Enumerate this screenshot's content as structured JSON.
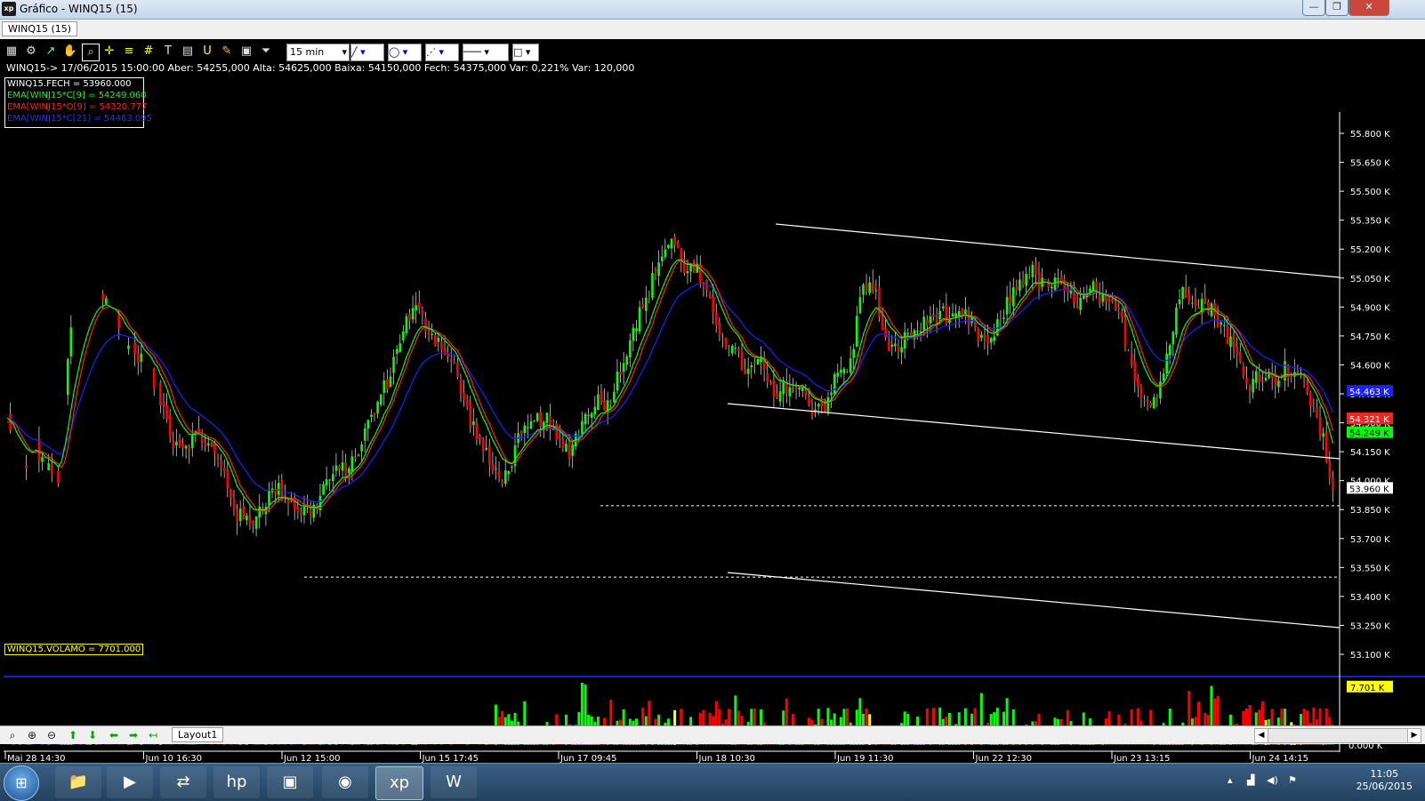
{
  "window": {
    "title": "Gráfico - WINQ15 (15)",
    "tab": "WINQ15 (15)",
    "controls": [
      "—",
      "❐",
      "✕"
    ]
  },
  "toolbar": {
    "timeframe": "15 min",
    "icons": [
      "chart-type-icon",
      "settings-icon",
      "cursor-icon",
      "hand-icon",
      "zoom-tool-icon",
      "crosshair-icon",
      "hline-icon",
      "grid-icon",
      "text-icon",
      "calculator-icon",
      "u-icon",
      "brush-icon",
      "save-icon",
      "filter-icon"
    ]
  },
  "info_line": "WINQ15-> 17/06/2015 15:00:00 Aber: 54255,000 Alta: 54625,000 Baixa: 54150,000 Fech: 54375,000 Var: 0,221% Var: 120,000",
  "legend": [
    {
      "text": "WINQ15.FECH = 53960.000",
      "color": "#ffffff"
    },
    {
      "text": "EMA[WINJ15*C[9] = 54249.060",
      "color": "#00ff00"
    },
    {
      "text": "EMA[WINJ15*O[9] = 54320.777",
      "color": "#ff2020"
    },
    {
      "text": "EMA[WINJ15*C[21] = 54463.095",
      "color": "#2030ff"
    }
  ],
  "volume_label": "WINQ15.VOLAMO = 7701.000",
  "colors": {
    "up": "#00ff00",
    "down": "#ff0000",
    "ema_fast": "#00ff00",
    "ema_open": "#ff2020",
    "ema_slow": "#1a22ff",
    "trendline": "#ffffff"
  },
  "chart_data": {
    "type": "candlestick",
    "symbol": "WINQ15",
    "interval": "15 min",
    "y_axis_ticks": [
      "55.800 K",
      "55.650 K",
      "55.500 K",
      "55.350 K",
      "55.200 K",
      "55.050 K",
      "54.900 K",
      "54.750 K",
      "54.600 K",
      "54.450 K",
      "54.300 K",
      "54.150 K",
      "54.000 K",
      "53.850 K",
      "53.700 K",
      "53.550 K",
      "53.400 K",
      "53.250 K",
      "53.100 K"
    ],
    "ylim": [
      53000,
      55900
    ],
    "x_axis_ticks": [
      "Mai 28 14:30",
      "Jun 10 16:30",
      "Jun 12 15:00",
      "Jun 15 17:45",
      "Jun 17 09:45",
      "Jun 18 10:30",
      "Jun 19 11:30",
      "Jun 22 12:30",
      "Jun 23 13:15",
      "Jun 24 14:15"
    ],
    "price_markers": [
      {
        "label": "54.463 K",
        "value": 54463,
        "color": "#1a22ff"
      },
      {
        "label": "54.321 K",
        "value": 54321,
        "color": "#ff2020"
      },
      {
        "label": "54.249 K",
        "value": 54249,
        "color": "#00ff00"
      },
      {
        "label": "53.960 K",
        "value": 53960,
        "color": "#ffffff"
      }
    ],
    "close_path": [
      [
        0,
        54310
      ],
      [
        3,
        54120
      ],
      [
        6,
        54040
      ],
      [
        9,
        54180
      ],
      [
        12,
        54060
      ],
      [
        16,
        54020
      ],
      [
        20,
        54800
      ],
      [
        24,
        54950
      ],
      [
        28,
        55020
      ],
      [
        32,
        54900
      ],
      [
        36,
        54750
      ],
      [
        40,
        54660
      ],
      [
        44,
        54580
      ],
      [
        48,
        54420
      ],
      [
        52,
        54210
      ],
      [
        56,
        54190
      ],
      [
        60,
        54240
      ],
      [
        64,
        54160
      ],
      [
        68,
        54030
      ],
      [
        72,
        53820
      ],
      [
        76,
        53780
      ],
      [
        80,
        53880
      ],
      [
        84,
        53960
      ],
      [
        88,
        53910
      ],
      [
        92,
        53840
      ],
      [
        96,
        53850
      ],
      [
        100,
        54000
      ],
      [
        104,
        54050
      ],
      [
        108,
        54080
      ],
      [
        112,
        54250
      ],
      [
        116,
        54400
      ],
      [
        120,
        54560
      ],
      [
        124,
        54800
      ],
      [
        128,
        54890
      ],
      [
        132,
        54780
      ],
      [
        136,
        54710
      ],
      [
        140,
        54580
      ],
      [
        144,
        54360
      ],
      [
        148,
        54200
      ],
      [
        152,
        54050
      ],
      [
        156,
        54020
      ],
      [
        160,
        54200
      ],
      [
        164,
        54280
      ],
      [
        168,
        54340
      ],
      [
        172,
        54200
      ],
      [
        176,
        54160
      ],
      [
        180,
        54300
      ],
      [
        184,
        54420
      ],
      [
        188,
        54400
      ],
      [
        192,
        54580
      ],
      [
        196,
        54800
      ],
      [
        200,
        54920
      ],
      [
        204,
        55150
      ],
      [
        208,
        55250
      ],
      [
        212,
        55110
      ],
      [
        216,
        55080
      ],
      [
        220,
        54900
      ],
      [
        224,
        54750
      ],
      [
        228,
        54650
      ],
      [
        232,
        54560
      ],
      [
        236,
        54620
      ],
      [
        240,
        54410
      ],
      [
        244,
        54500
      ],
      [
        248,
        54480
      ],
      [
        252,
        54380
      ],
      [
        256,
        54400
      ],
      [
        260,
        54550
      ],
      [
        264,
        54600
      ],
      [
        268,
        55050
      ],
      [
        272,
        54950
      ],
      [
        276,
        54650
      ],
      [
        280,
        54720
      ],
      [
        284,
        54770
      ],
      [
        288,
        54820
      ],
      [
        292,
        54880
      ],
      [
        296,
        54820
      ],
      [
        300,
        54850
      ],
      [
        304,
        54750
      ],
      [
        308,
        54700
      ],
      [
        312,
        54880
      ],
      [
        316,
        55010
      ],
      [
        320,
        55100
      ],
      [
        324,
        55010
      ],
      [
        328,
        55020
      ],
      [
        332,
        54970
      ],
      [
        336,
        54920
      ],
      [
        340,
        54990
      ],
      [
        344,
        54900
      ],
      [
        348,
        54880
      ],
      [
        352,
        54600
      ],
      [
        356,
        54420
      ],
      [
        360,
        54440
      ],
      [
        364,
        54720
      ],
      [
        368,
        55000
      ],
      [
        372,
        54950
      ],
      [
        376,
        54900
      ],
      [
        380,
        54820
      ],
      [
        384,
        54680
      ],
      [
        388,
        54500
      ],
      [
        392,
        54560
      ],
      [
        396,
        54520
      ],
      [
        400,
        54580
      ],
      [
        404,
        54560
      ],
      [
        408,
        54420
      ],
      [
        412,
        54200
      ],
      [
        415,
        53960
      ]
    ],
    "series": [
      {
        "name": "EMA[WINJ15*C[9]",
        "color": "#00ff00",
        "last": 54249.06
      },
      {
        "name": "EMA[WINJ15*O[9]",
        "color": "#ff2020",
        "last": 54320.777
      },
      {
        "name": "EMA[WINJ15*C[21]",
        "color": "#1a22ff",
        "last": 54463.095
      }
    ],
    "support_levels": [
      53870,
      53500
    ],
    "volume": {
      "y_ticks": [
        "7.701 K",
        "0.000 K"
      ],
      "last": 7701
    }
  },
  "bottom": {
    "layout_tab": "Layout1"
  },
  "taskbar": {
    "time": "11:05",
    "date": "25/06/2015"
  }
}
